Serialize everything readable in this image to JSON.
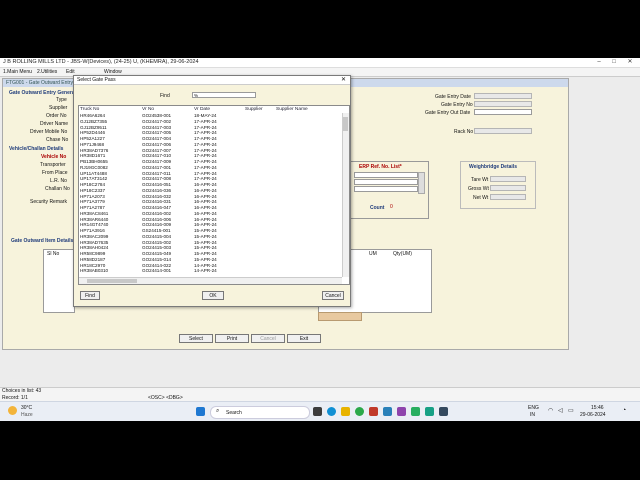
{
  "window": {
    "title": "J B ROLLING MILLS LTD - JBS-W(Devices), (24-25) U, (KHEMRA), 29-06-2024"
  },
  "menubar": {
    "items": [
      "1.Main Menu",
      "2.Utilities",
      "Edit",
      "Window"
    ]
  },
  "form": {
    "title": "FTG001 - Gate Outward Entry",
    "section_general": "Gate Outward Entry General",
    "labels": {
      "type": "Type",
      "supplier": "Supplier",
      "order_no": "Order No",
      "driver_name": "Driver Name",
      "driver_mobile": "Driver Mobile No",
      "chase_no": "Chase No",
      "vehicle_section": "Vehicle/Challan Details",
      "vehicle_no": "Vehicle No",
      "transporter": "Transporter",
      "from_place": "From Place",
      "lr_no": "L.R. No",
      "challan_no": "Challan No",
      "security_remark": "Security Remark",
      "gate_entry_date": "Gate Entry Date",
      "gate_entry_no": "Gate Entry No",
      "gate_entry_out_date": "Gate Entry Out Date",
      "rack_no": "Rack No",
      "erp_ref": "ERP Ref. No. List*",
      "count": "Count",
      "count_value": "0",
      "weighbridge": "Weighbridge Details",
      "tare_wt": "Tare Wt",
      "gross_wt": "Gross Wt",
      "net_wt": "Net Wt",
      "item_section": "Gate Outward Item Details",
      "col_sno": "Sl No",
      "col_um": "UM",
      "col_qty": "Qty(UM)"
    },
    "buttons": {
      "select": "Select",
      "print": "Print",
      "cancel": "Cancel",
      "exit": "Exit"
    }
  },
  "dialog": {
    "title": "Select Gate Pass",
    "find_label": "Find",
    "find_value": "%",
    "columns": [
      "Truck No",
      "Vr No",
      "Vr Date",
      "Supplier",
      "Supplier Name"
    ],
    "rows": [
      [
        "HR46A6264",
        "GO24538-001",
        "18-MAY-24"
      ],
      [
        "GJ12BZ7355",
        "GO24417-002",
        "17-APR-24"
      ],
      [
        "GJ12BZ9511",
        "GO24417-003",
        "17-APR-24"
      ],
      [
        "HP52D4446",
        "GO24417-005",
        "17-APR-24"
      ],
      [
        "HP52A1227",
        "GO24417-004",
        "17-APR-24"
      ],
      [
        "HP71J9468",
        "GO24417-006",
        "17-APR-24"
      ],
      [
        "HR38AD7376",
        "GO24417-007",
        "17-APR-24"
      ],
      [
        "HR38D1671",
        "GO24417-010",
        "17-APR-24"
      ],
      [
        "PB13BH0655",
        "GO24417-009",
        "17-APR-24"
      ],
      [
        "RJ19GC0082",
        "GO24417-001",
        "17-APR-24"
      ],
      [
        "UP11AT4488",
        "GO24417-011",
        "17-APR-24"
      ],
      [
        "UP17AT3142",
        "GO24417-008",
        "17-APR-24"
      ],
      [
        "HP18C2784",
        "GO24416-051",
        "16-APR-24"
      ],
      [
        "HP18C2337",
        "GO24416-036",
        "16-APR-24"
      ],
      [
        "HP71A2073",
        "GO24416-032",
        "16-APR-24"
      ],
      [
        "HP71A3779",
        "GO24416-031",
        "16-APR-24"
      ],
      [
        "HP71A2787",
        "GO24416-047",
        "16-APR-24"
      ],
      [
        "HR38AC8461",
        "GO24416-002",
        "16-APR-24"
      ],
      [
        "HR38AR6440",
        "GO24416-006",
        "16-APR-24"
      ],
      [
        "HR14GT4740",
        "GO24416-009",
        "16-APR-24"
      ],
      [
        "HP71A3916",
        "GS24415-001",
        "15-APR-24"
      ],
      [
        "HR38AC2099",
        "GO24415-004",
        "15-APR-24"
      ],
      [
        "HR38AD7635",
        "GO24415-002",
        "15-APR-24"
      ],
      [
        "HR38AH0424",
        "GO24415-003",
        "15-APR-24"
      ],
      [
        "HR58C9899",
        "GO24415-049",
        "15-APR-24"
      ],
      [
        "HR58D2187",
        "GO24415-014",
        "15-APR-24"
      ],
      [
        "HR18C2970",
        "GO24414-022",
        "14-APR-24"
      ],
      [
        "HR38AB0310",
        "GO24414-001",
        "14-APR-24"
      ]
    ],
    "buttons": {
      "find": "Find",
      "ok": "OK",
      "cancel": "Cancel"
    }
  },
  "statusbar": {
    "line1": "Choices in list: 43",
    "line2": "Record: 1/1",
    "center": "<OSC> <DBG>"
  },
  "taskbar": {
    "weather_temp": "30°C",
    "weather_text": "Haze",
    "search_placeholder": "Search",
    "lang": "ENG",
    "region": "IN",
    "time": "15:46",
    "date": "29-06-2024"
  }
}
